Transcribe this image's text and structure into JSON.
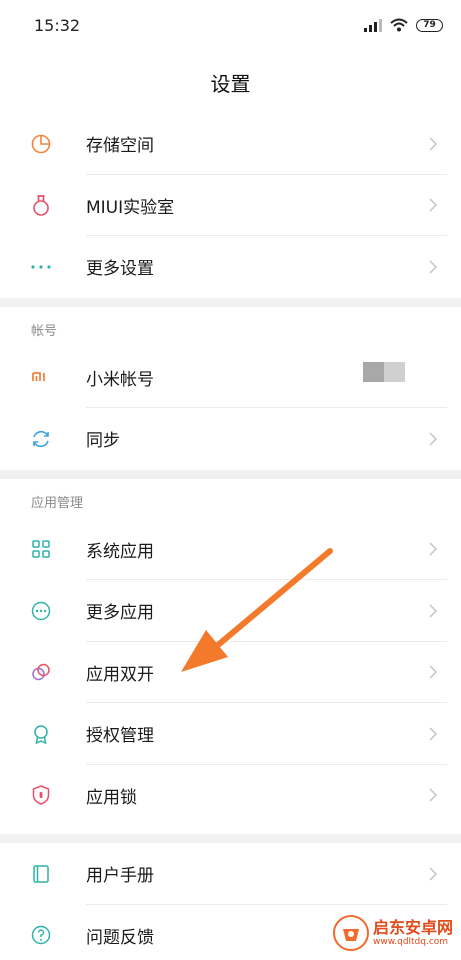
{
  "status_bar": {
    "time": "15:32",
    "battery": "79"
  },
  "header": {
    "title": "设置"
  },
  "group_top": [
    {
      "name": "storage",
      "label": "存储空间",
      "icon": "pie-chart-icon"
    },
    {
      "name": "miui-lab",
      "label": "MIUI实验室",
      "icon": "flask-icon"
    },
    {
      "name": "more-settings",
      "label": "更多设置",
      "icon": "more-dots-icon"
    }
  ],
  "sections": {
    "account": {
      "title": "帐号",
      "items": [
        {
          "name": "mi-account",
          "label": "小米帐号",
          "icon": "mi-logo-icon"
        },
        {
          "name": "sync",
          "label": "同步",
          "icon": "sync-icon"
        }
      ]
    },
    "apps": {
      "title": "应用管理",
      "items": [
        {
          "name": "system-apps",
          "label": "系统应用",
          "icon": "grid-icon"
        },
        {
          "name": "more-apps",
          "label": "更多应用",
          "icon": "more-circle-icon"
        },
        {
          "name": "dual-apps",
          "label": "应用双开",
          "icon": "dual-circles-icon"
        },
        {
          "name": "permissions",
          "label": "授权管理",
          "icon": "badge-icon"
        },
        {
          "name": "app-lock",
          "label": "应用锁",
          "icon": "shield-lock-icon"
        }
      ]
    }
  },
  "group_bottom": [
    {
      "name": "user-guide",
      "label": "用户手册",
      "icon": "book-icon"
    },
    {
      "name": "feedback",
      "label": "问题反馈",
      "icon": "question-icon"
    }
  ],
  "watermark": {
    "title": "启东安卓网",
    "url": "www.qdltdq.com"
  },
  "colors": {
    "orange": "#f2843e",
    "pink": "#e8506a",
    "teal": "#2fb4a9",
    "blue": "#3aa3e0",
    "purple": "#9b6fd6",
    "annotation_arrow": "#f27a2a"
  }
}
